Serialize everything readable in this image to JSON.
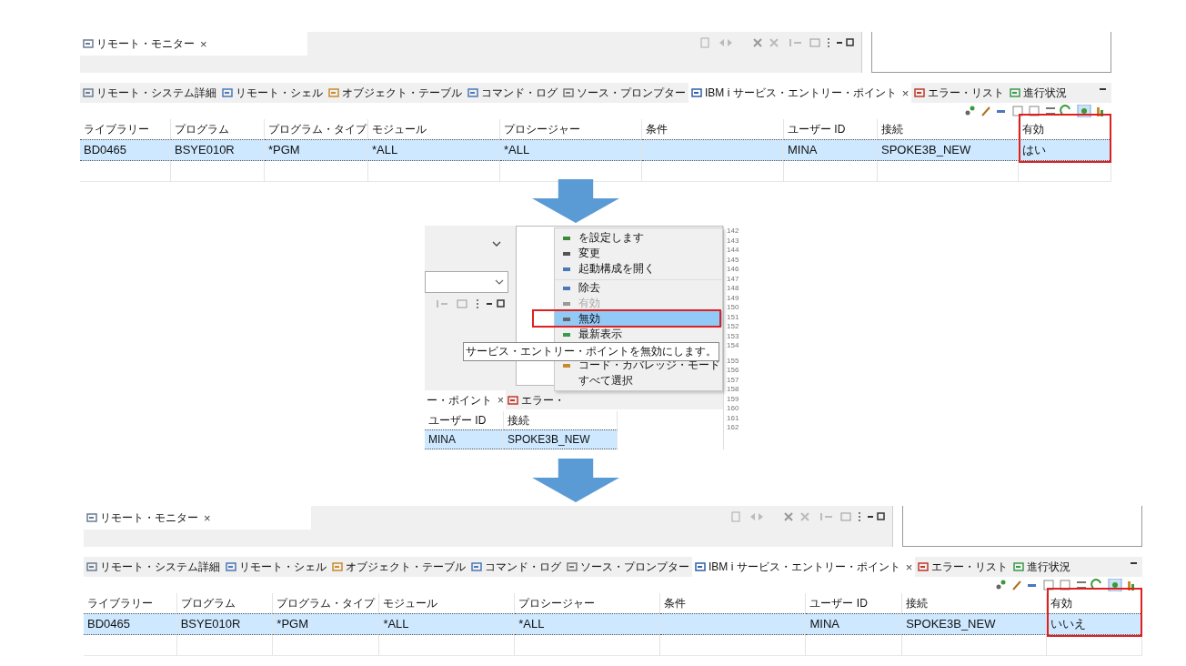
{
  "panels": [
    {
      "kind": "view",
      "monitor_tab": {
        "label": "リモート・モニター",
        "close": "×"
      },
      "tabs": [
        {
          "label": "リモート・システム詳細",
          "selected": false
        },
        {
          "label": "リモート・シェル",
          "selected": false
        },
        {
          "label": "オブジェクト・テーブル",
          "selected": false
        },
        {
          "label": "コマンド・ログ",
          "selected": false
        },
        {
          "label": "ソース・プロンプター",
          "selected": false
        },
        {
          "label": "IBM i サービス・エントリー・ポイント",
          "selected": true,
          "close": "×"
        },
        {
          "label": "エラー・リスト",
          "selected": false
        },
        {
          "label": "進行状況",
          "selected": false
        }
      ],
      "columns": [
        {
          "label": "ライブラリー",
          "highlighted": false
        },
        {
          "label": "プログラム",
          "highlighted": false
        },
        {
          "label": "プログラム・タイプ",
          "highlighted": false
        },
        {
          "label": "モジュール",
          "highlighted": false
        },
        {
          "label": "プロシージャー",
          "highlighted": false
        },
        {
          "label": "条件",
          "highlighted": false
        },
        {
          "label": "ユーザー ID",
          "highlighted": false
        },
        {
          "label": "接続",
          "highlighted": false
        },
        {
          "label": "有効",
          "highlighted": true
        }
      ],
      "rows": [
        {
          "cells": [
            "BD0465",
            "BSYE010R",
            "*PGM",
            "*ALL",
            "*ALL",
            "",
            "MINA",
            "SPOKE3B_NEW",
            "はい"
          ],
          "selected": true
        }
      ]
    },
    {
      "kind": "menu_shot",
      "tabs": [
        {
          "label": "ー・ポイント",
          "selected": true,
          "close": "×"
        },
        {
          "label": "エラー・",
          "selected": false
        }
      ],
      "columns": [
        {
          "label": "ユーザー ID",
          "highlighted": false
        },
        {
          "label": "接続",
          "highlighted": false
        }
      ],
      "rows": [
        {
          "cells": [
            "MINA",
            "SPOKE3B_NEW"
          ],
          "selected": true
        }
      ],
      "menu": [
        {
          "label": "を設定します",
          "disabled": false,
          "selected": false
        },
        {
          "label": "変更",
          "disabled": false,
          "selected": false
        },
        {
          "label": "起動構成を開く",
          "disabled": false,
          "selected": false
        },
        {
          "label": "除去",
          "disabled": false,
          "selected": false
        },
        {
          "label": "有効",
          "disabled": true,
          "selected": false
        },
        {
          "label": "無効",
          "disabled": false,
          "selected": true,
          "tooltip": "サービス・エントリー・ポイントを無効にします。"
        },
        {
          "label": "最新表示",
          "disabled": false,
          "selected": false
        },
        {
          "label": "コード・カバレッジ・モード",
          "disabled": false,
          "selected": false
        },
        {
          "label": "すべて選択",
          "disabled": false,
          "selected": false
        }
      ],
      "line_numbers": [
        "142",
        "143",
        "144",
        "145",
        "146",
        "147",
        "148",
        "149",
        "150",
        "151",
        "152",
        "153",
        "154",
        "155",
        "156",
        "157",
        "158",
        "159",
        "160",
        "161",
        "162"
      ]
    },
    {
      "kind": "view",
      "monitor_tab": {
        "label": "リモート・モニター",
        "close": "×"
      },
      "tabs": [
        {
          "label": "リモート・システム詳細",
          "selected": false
        },
        {
          "label": "リモート・シェル",
          "selected": false
        },
        {
          "label": "オブジェクト・テーブル",
          "selected": false
        },
        {
          "label": "コマンド・ログ",
          "selected": false
        },
        {
          "label": "ソース・プロンプター",
          "selected": false
        },
        {
          "label": "IBM i サービス・エントリー・ポイント",
          "selected": true,
          "close": "×"
        },
        {
          "label": "エラー・リスト",
          "selected": false
        },
        {
          "label": "進行状況",
          "selected": false
        }
      ],
      "columns": [
        {
          "label": "ライブラリー",
          "highlighted": false
        },
        {
          "label": "プログラム",
          "highlighted": false
        },
        {
          "label": "プログラム・タイプ",
          "highlighted": false
        },
        {
          "label": "モジュール",
          "highlighted": false
        },
        {
          "label": "プロシージャー",
          "highlighted": false
        },
        {
          "label": "条件",
          "highlighted": false
        },
        {
          "label": "ユーザー ID",
          "highlighted": false
        },
        {
          "label": "接続",
          "highlighted": false
        },
        {
          "label": "有効",
          "highlighted": true
        }
      ],
      "rows": [
        {
          "cells": [
            "BD0465",
            "BSYE010R",
            "*PGM",
            "*ALL",
            "*ALL",
            "",
            "MINA",
            "SPOKE3B_NEW",
            "いいえ"
          ],
          "selected": true
        }
      ]
    }
  ]
}
